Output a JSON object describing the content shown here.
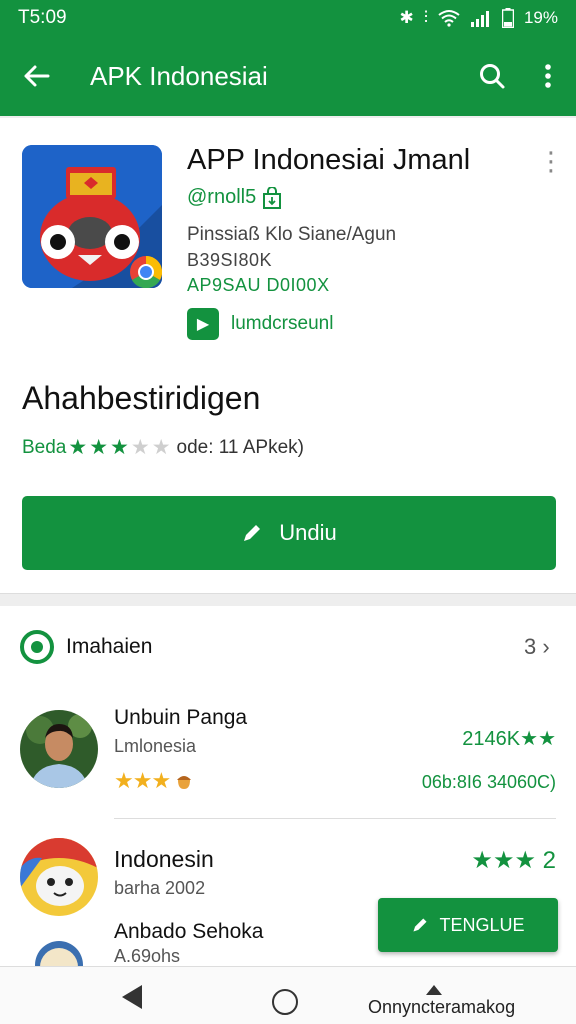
{
  "status_bar": {
    "time": "T5:09",
    "battery": "19%"
  },
  "app_bar": {
    "title": "APK Indonesiai"
  },
  "app": {
    "title": "APP Indonesiai  Jmanl",
    "developer": "@rnoll5",
    "meta_line_1": "Pinssiaß Klo Siane/Agun",
    "meta_line_2": "B39SI80K",
    "meta_line_3": "AP9SAU D0I00X",
    "install_label": "lumdcrseunl"
  },
  "section": {
    "title": "Ahahbestiridigen",
    "rating_label": "Beda",
    "rating_stars": 3,
    "rating_text": "ode: 11 APkek)"
  },
  "download_button": {
    "label": "Undiu"
  },
  "list": {
    "title": "Imahaien",
    "count": "3",
    "items": [
      {
        "name": "Unbuin Panga",
        "sub": "Lmlonesia",
        "stars": 3,
        "right_top": "2146K",
        "right_bottom": "06b:8I6 34060C)"
      },
      {
        "name": "Indonesin",
        "sub": "barha 2002",
        "right_top": "2"
      },
      {
        "name": "Anbado Sehoka",
        "sub": "A.69ohs"
      }
    ]
  },
  "fab": {
    "label": "TENGLUE"
  },
  "nav": {
    "recent_label": "Onnyncteramakog"
  }
}
